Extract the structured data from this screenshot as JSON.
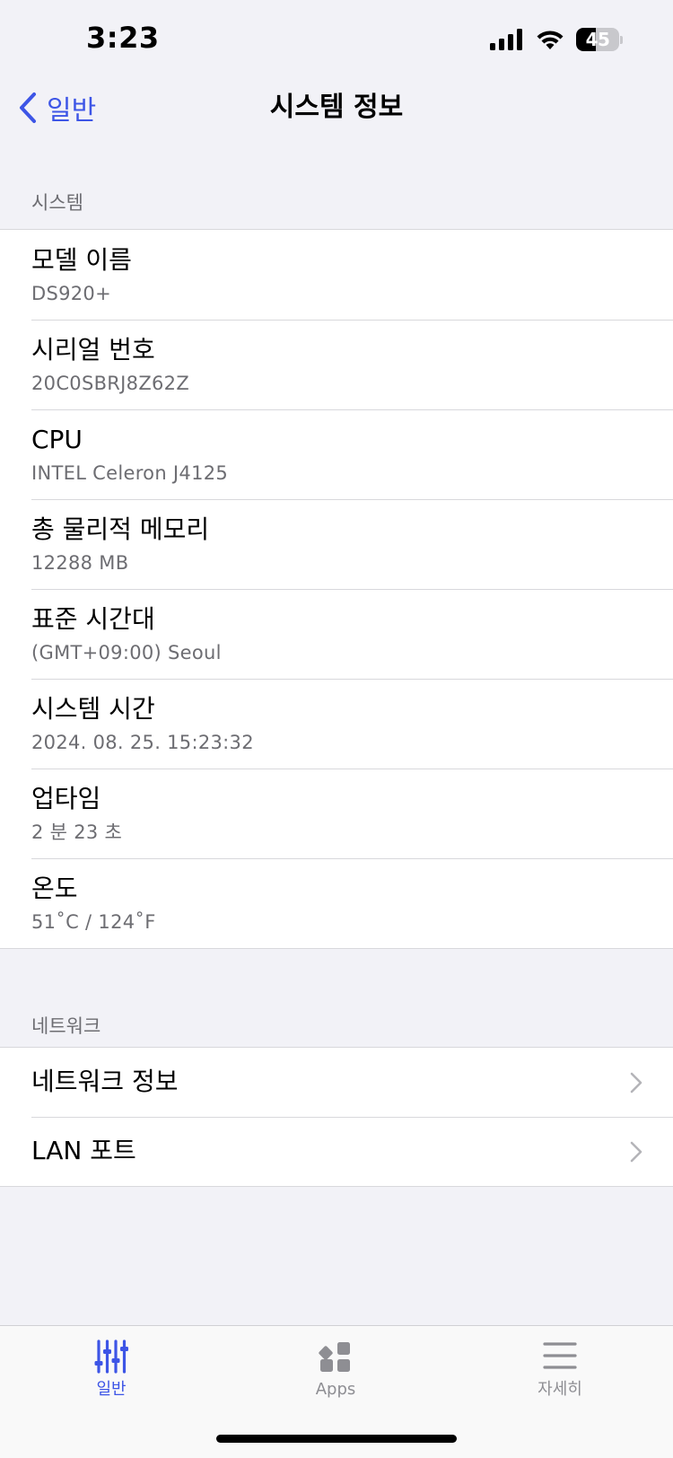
{
  "status_bar": {
    "time": "3:23",
    "battery_level": "45",
    "battery_percent": 45,
    "icons": [
      "signal-icon",
      "wifi-icon",
      "battery-icon"
    ]
  },
  "nav": {
    "back_label": "일반",
    "title": "시스템 정보",
    "accent_color": "#3d55e6"
  },
  "system_section": {
    "header": "시스템",
    "rows": [
      {
        "title": "모델 이름",
        "value": "DS920+"
      },
      {
        "title": "시리얼 번호",
        "value": "20C0SBRJ8Z62Z"
      },
      {
        "title": "CPU",
        "value": "INTEL Celeron J4125"
      },
      {
        "title": "총 물리적 메모리",
        "value": "12288 MB"
      },
      {
        "title": "표준 시간대",
        "value": "(GMT+09:00) Seoul"
      },
      {
        "title": "시스템 시간",
        "value": "2024. 08. 25. 15:23:32"
      },
      {
        "title": "업타임",
        "value": "2 분 23 초"
      },
      {
        "title": "온도",
        "value": "51˚C / 124˚F"
      }
    ]
  },
  "network_section": {
    "header": "네트워크",
    "rows": [
      {
        "label": "네트워크 정보",
        "icon": "chevron-right-icon"
      },
      {
        "label": "LAN 포트",
        "icon": "chevron-right-icon"
      }
    ]
  },
  "tab_bar": {
    "tabs": [
      {
        "label": "일반",
        "icon": "sliders-icon",
        "active": true,
        "color": "#3d55e6"
      },
      {
        "label": "Apps",
        "icon": "apps-grid-icon",
        "active": false,
        "color": "#8e8e93"
      },
      {
        "label": "자세히",
        "icon": "menu-icon",
        "active": false,
        "color": "#8e8e93"
      }
    ]
  }
}
